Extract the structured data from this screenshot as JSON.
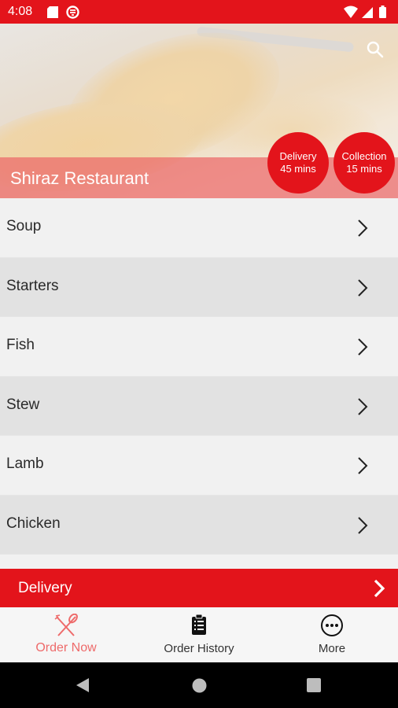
{
  "status_bar": {
    "time": "4:08",
    "icons_left": [
      "sd-card-icon",
      "app-notification-icon"
    ],
    "icons_right": [
      "wifi-icon",
      "signal-icon",
      "battery-icon"
    ]
  },
  "header": {
    "restaurant_name": "Shiraz Restaurant",
    "search_icon": "search-icon",
    "delivery_badge": {
      "title": "Delivery",
      "time": "45 mins"
    },
    "collection_badge": {
      "title": "Collection",
      "time": "15 mins"
    }
  },
  "categories": [
    {
      "label": "Soup"
    },
    {
      "label": "Starters"
    },
    {
      "label": "Fish"
    },
    {
      "label": "Stew"
    },
    {
      "label": "Lamb"
    },
    {
      "label": "Chicken"
    }
  ],
  "delivery_bar": {
    "label": "Delivery"
  },
  "bottom_nav": [
    {
      "label": "Order Now",
      "icon": "fork-knife-icon",
      "active": true
    },
    {
      "label": "Order History",
      "icon": "clipboard-icon",
      "active": false
    },
    {
      "label": "More",
      "icon": "more-icon",
      "active": false
    }
  ],
  "colors": {
    "accent": "#e3141b",
    "active_nav": "#ee6a6a",
    "row_light": "#f1f1f1",
    "row_dark": "#e2e2e2"
  }
}
